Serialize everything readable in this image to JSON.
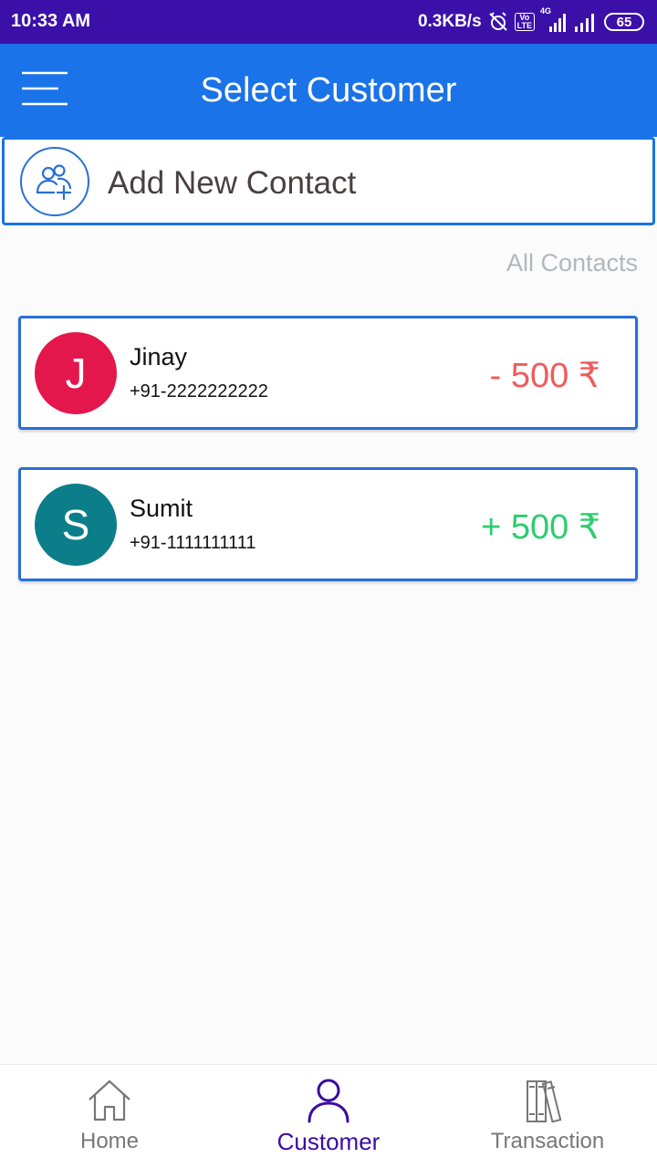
{
  "status_bar": {
    "time": "10:33 AM",
    "net_speed": "0.3KB/s",
    "lte_top": "Vo",
    "lte_bottom": "LTE",
    "net_type": "4G",
    "battery": "65"
  },
  "app_bar": {
    "title": "Select Customer",
    "menu_icon": "hamburger-menu-icon"
  },
  "add_contact": {
    "label": "Add New Contact",
    "icon": "add-user-icon"
  },
  "section_label": "All Contacts",
  "contacts": [
    {
      "initial": "J",
      "name": "Jinay",
      "phone": "+91-2222222222",
      "amount": "- 500 ₹",
      "avatar_color": "#e3174b",
      "amount_color": "#ef5c5c"
    },
    {
      "initial": "S",
      "name": "Sumit",
      "phone": "+91-1111111111",
      "amount": "+ 500 ₹",
      "avatar_color": "#0b7e8a",
      "amount_color": "#2ecc71"
    }
  ],
  "bottom_nav": [
    {
      "label": "Home",
      "icon": "home-icon",
      "active": false
    },
    {
      "label": "Customer",
      "icon": "person-icon",
      "active": true
    },
    {
      "label": "Transaction",
      "icon": "books-icon",
      "active": false
    }
  ],
  "colors": {
    "status_bar": "#3b10a9",
    "app_bar": "#1a73e8",
    "active_nav": "#3a0ca3"
  }
}
